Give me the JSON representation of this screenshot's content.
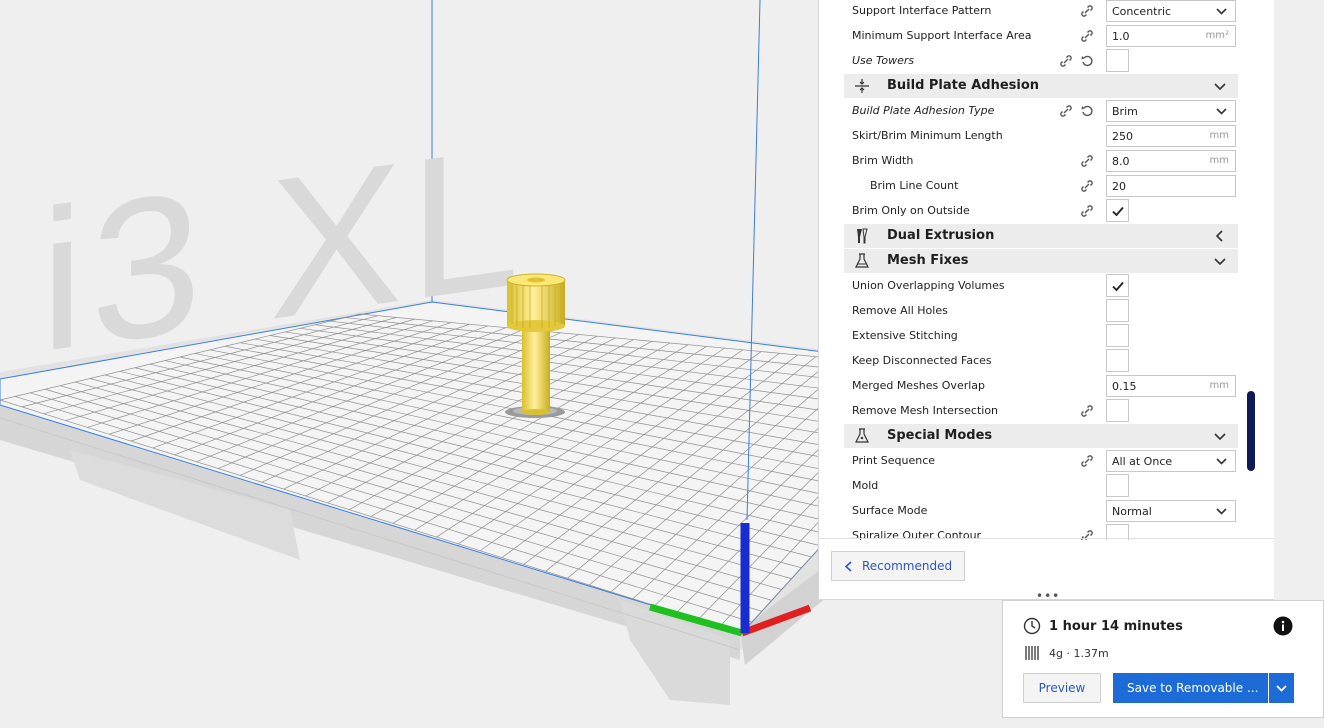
{
  "viewport": {
    "printer_label": "i3 XL"
  },
  "settings": {
    "rows": {
      "support_interface_pattern": {
        "label": "Support Interface Pattern",
        "value": "Concentric"
      },
      "min_support_interface_area": {
        "label": "Minimum Support Interface Area",
        "value": "1.0",
        "unit": "mm²"
      },
      "use_towers": {
        "label": "Use Towers"
      },
      "build_plate_adhesion_type": {
        "label": "Build Plate Adhesion Type",
        "value": "Brim"
      },
      "skirt_brim_min_length": {
        "label": "Skirt/Brim Minimum Length",
        "value": "250",
        "unit": "mm"
      },
      "brim_width": {
        "label": "Brim Width",
        "value": "8.0",
        "unit": "mm"
      },
      "brim_line_count": {
        "label": "Brim Line Count",
        "value": "20"
      },
      "brim_only_outside": {
        "label": "Brim Only on Outside",
        "checked": true
      },
      "union_overlapping": {
        "label": "Union Overlapping Volumes",
        "checked": true
      },
      "remove_all_holes": {
        "label": "Remove All Holes",
        "checked": false
      },
      "extensive_stitching": {
        "label": "Extensive Stitching",
        "checked": false
      },
      "keep_disconnected": {
        "label": "Keep Disconnected Faces",
        "checked": false
      },
      "merged_meshes_overlap": {
        "label": "Merged Meshes Overlap",
        "value": "0.15",
        "unit": "mm"
      },
      "remove_mesh_intersection": {
        "label": "Remove Mesh Intersection",
        "checked": false
      },
      "print_sequence": {
        "label": "Print Sequence",
        "value": "All at Once"
      },
      "mold": {
        "label": "Mold",
        "checked": false
      },
      "surface_mode": {
        "label": "Surface Mode",
        "value": "Normal"
      },
      "spiralize": {
        "label": "Spiralize Outer Contour",
        "checked": false
      }
    },
    "categories": {
      "build_plate_adhesion": "Build Plate Adhesion",
      "dual_extrusion": "Dual Extrusion",
      "mesh_fixes": "Mesh Fixes",
      "special_modes": "Special Modes"
    },
    "recommended_label": "Recommended",
    "drag_handle": "•••"
  },
  "action_panel": {
    "print_time": "1 hour 14 minutes",
    "material": "4g · 1.37m",
    "preview_label": "Preview",
    "save_label": "Save to Removable ..."
  },
  "colors": {
    "accent": "#1c6bd6",
    "scroll_thumb": "#0e1a57",
    "axis_x": "#e02020",
    "axis_y": "#20c020",
    "axis_z": "#1a2bd0",
    "model": "#f6e05a"
  }
}
